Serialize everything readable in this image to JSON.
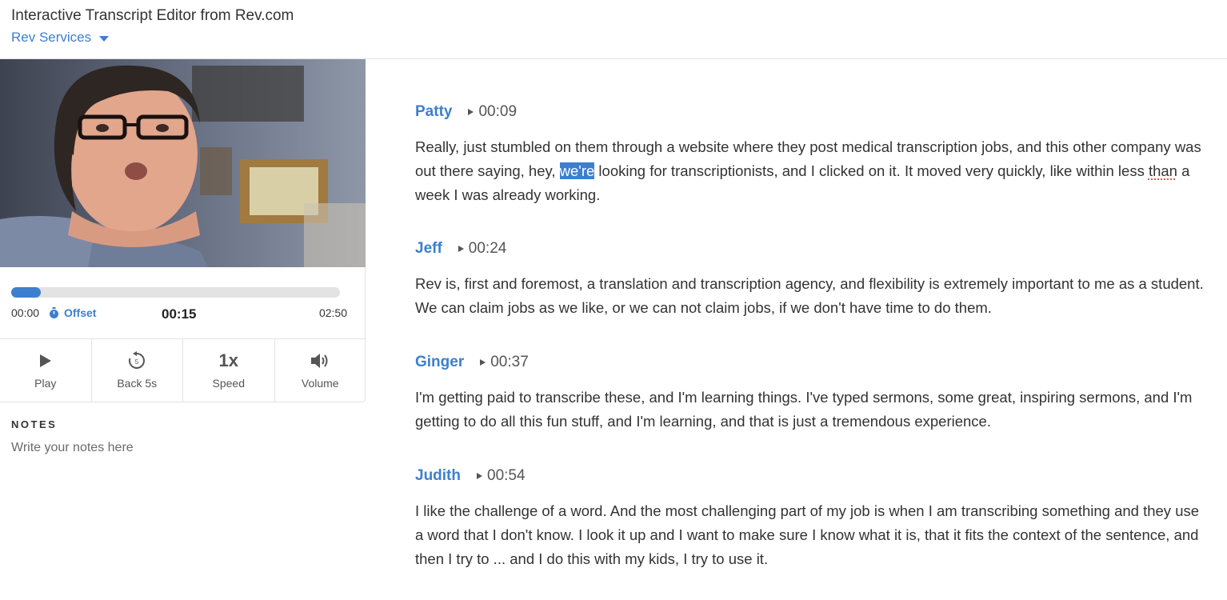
{
  "header": {
    "title": "Interactive Transcript Editor from Rev.com",
    "services_label": "Rev Services"
  },
  "player": {
    "progress": 0.09,
    "time_start": "00:00",
    "offset_label": "Offset",
    "time_current": "00:15",
    "time_end": "02:50",
    "controls": [
      {
        "name": "play",
        "label": "Play",
        "icon": "play-icon"
      },
      {
        "name": "back",
        "label": "Back 5s",
        "icon": "rewind-5-icon"
      },
      {
        "name": "speed",
        "label": "Speed",
        "value": "1x"
      },
      {
        "name": "volume",
        "label": "Volume",
        "icon": "speaker-icon"
      }
    ]
  },
  "notes": {
    "title": "NOTES",
    "placeholder": "Write your notes here"
  },
  "transcript": [
    {
      "speaker": "Patty",
      "time": "00:09",
      "p1": "Really, just stumbled on them through a website where they post medical transcription jobs, and this other company was out there saying, hey, ",
      "highlight": "we're",
      "p2": " looking for transcriptionists, and I clicked on it. It moved very quickly, like within less ",
      "misspelled": "than",
      "p3": " a week I was already working."
    },
    {
      "speaker": "Jeff",
      "time": "00:24",
      "text": "Rev is, first and foremost, a translation and transcription agency, and flexibility is extremely important to me as a student. We can claim jobs as we like, or we can not claim jobs, if we don't have time to do them."
    },
    {
      "speaker": "Ginger",
      "time": "00:37",
      "text": "I'm getting paid to transcribe these, and I'm learning things. I've typed sermons, some great, inspiring sermons, and I'm getting to do all this fun stuff, and I'm learning, and that is just a tremendous experience."
    },
    {
      "speaker": "Judith",
      "time": "00:54",
      "text": "I like the challenge of a word. And the most challenging part of my job is when I am transcribing something and they use a word that I don't know. I look it up and I want to make sure I know what it is, that it fits the context of the sentence, and then I try to ... and I do this with my kids, I try to use it."
    }
  ],
  "colors": {
    "accent": "#3d7fcf",
    "text": "#333333",
    "border": "#e3e3e3"
  }
}
